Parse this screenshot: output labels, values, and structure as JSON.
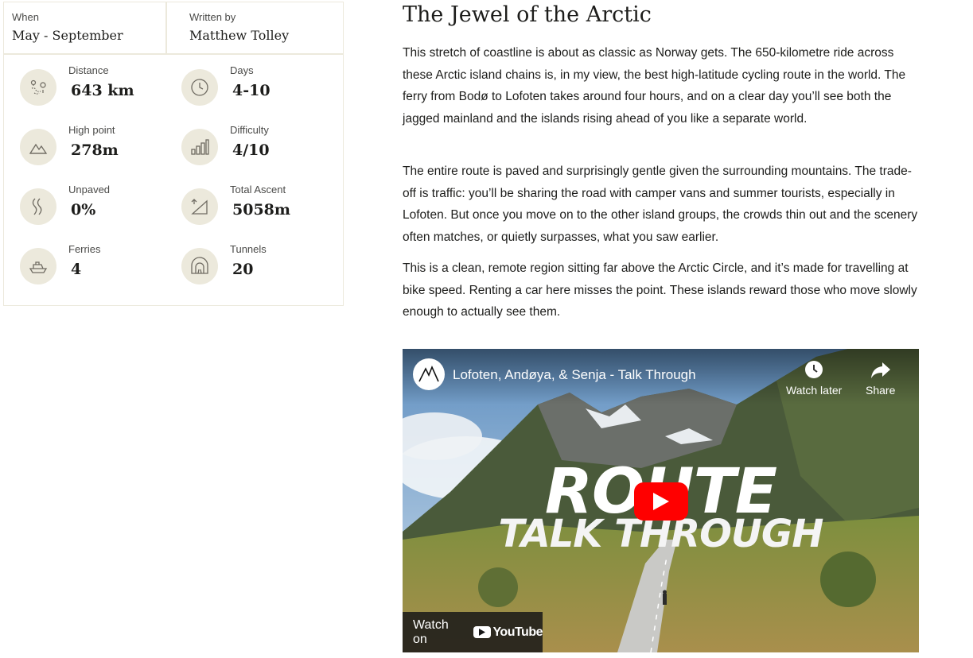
{
  "info": {
    "when_label": "When",
    "when_value": "May - September",
    "author_label": "Written by",
    "author_value": "Matthew Tolley",
    "stats": [
      {
        "label": "Distance",
        "value": "643 km",
        "icon": "map-route-icon"
      },
      {
        "label": "Days",
        "value": "4-10",
        "icon": "clock-icon"
      },
      {
        "label": "High point",
        "value": "278m",
        "icon": "mountain-icon"
      },
      {
        "label": "Difficulty",
        "value": "4/10",
        "icon": "bar-chart-icon"
      },
      {
        "label": "Unpaved",
        "value": "0%",
        "icon": "winding-road-icon"
      },
      {
        "label": "Total Ascent",
        "value": "5058m",
        "icon": "ascent-icon"
      },
      {
        "label": "Ferries",
        "value": "4",
        "icon": "ferry-icon"
      },
      {
        "label": "Tunnels",
        "value": "20",
        "icon": "tunnel-icon"
      }
    ]
  },
  "article": {
    "title": "The Jewel of the Arctic",
    "paragraphs": [
      "This stretch of coastline is about as classic as Norway gets. The 650-kilometre ride across these Arctic island chains is, in my view, the best high-latitude cycling route in the world. The ferry from Bodø to Lofoten takes around four hours, and on a clear day you’ll see both the jagged mainland and the islands rising ahead of you like a separate world.",
      "The entire route is paved and surprisingly gentle given the surrounding mountains. The trade-off is traffic: you’ll be sharing the road with camper vans and summer tourists, especially in Lofoten. But once you move on to the other island groups, the crowds thin out and the scenery often matches, or quietly surpasses, what you saw earlier.",
      "This is a clean, remote region sitting far above the Arctic Circle, and it’s made for travelling at bike speed. Renting a car here misses the point. These islands reward those who move slowly enough to actually see them."
    ]
  },
  "video": {
    "title": "Lofoten, Andøya, & Senja - Talk Through",
    "watch_later": "Watch later",
    "share": "Share",
    "overlay_line1": "ROUTE",
    "overlay_line2": "TALK THROUGH",
    "watch_on": "Watch on",
    "youtube": "YouTube",
    "play_color": "#ff0000"
  },
  "colors": {
    "accent_beige": "#ece9dc",
    "text": "#1d1d1b"
  }
}
